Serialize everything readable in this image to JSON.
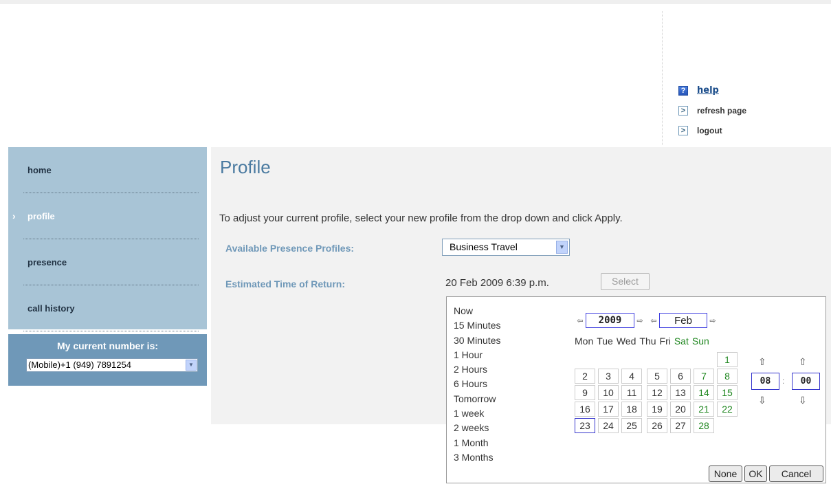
{
  "header": {
    "links": [
      {
        "label": "help",
        "icon": "help-icon"
      },
      {
        "label": "refresh page",
        "icon": "chevron-right-icon"
      },
      {
        "label": "logout",
        "icon": "chevron-right-icon"
      }
    ]
  },
  "sidebar": {
    "items": [
      {
        "label": "home",
        "active": false
      },
      {
        "label": "profile",
        "active": true
      },
      {
        "label": "presence",
        "active": false
      },
      {
        "label": "call history",
        "active": false
      }
    ],
    "number_label": "My current number is:",
    "number_value": "(Mobile)+1 (949) 7891254"
  },
  "main": {
    "title": "Profile",
    "instruction": "To adjust your current profile, select your new profile from the drop down and click Apply.",
    "profiles_label": "Available Presence Profiles:",
    "profile_value": "Business Travel",
    "return_label": "Estimated Time of Return:",
    "return_value": "20 Feb 2009 6:39 p.m.",
    "select_button": "Select"
  },
  "picker": {
    "quick_options": [
      "Now",
      "15 Minutes",
      "30 Minutes",
      "1 Hour",
      "2 Hours",
      "6 Hours",
      "Tomorrow",
      "1 week",
      "2 weeks",
      "1 Month",
      "3 Months"
    ],
    "year": "2009",
    "month": "Feb",
    "weekdays": [
      "Mon",
      "Tue",
      "Wed",
      "Thu",
      "Fri",
      "Sat",
      "Sun"
    ],
    "weeks": [
      [
        "",
        "",
        "",
        "",
        "",
        "",
        "1"
      ],
      [
        "2",
        "3",
        "4",
        "5",
        "6",
        "7",
        "8"
      ],
      [
        "9",
        "10",
        "11",
        "12",
        "13",
        "14",
        "15"
      ],
      [
        "16",
        "17",
        "18",
        "19",
        "20",
        "21",
        "22"
      ],
      [
        "23",
        "24",
        "25",
        "26",
        "27",
        "28",
        ""
      ]
    ],
    "selected_day": "23",
    "hour": "08",
    "minute": "00",
    "buttons": {
      "none": "None",
      "ok": "OK",
      "cancel": "Cancel"
    }
  },
  "colors": {
    "sidebar_bg": "#a8c4d6",
    "number_box_bg": "#6f98b8",
    "title_color": "#4a7aa0",
    "label_color": "#6f98b8",
    "weekend_color": "#228822",
    "selection_border": "#3333cc"
  }
}
